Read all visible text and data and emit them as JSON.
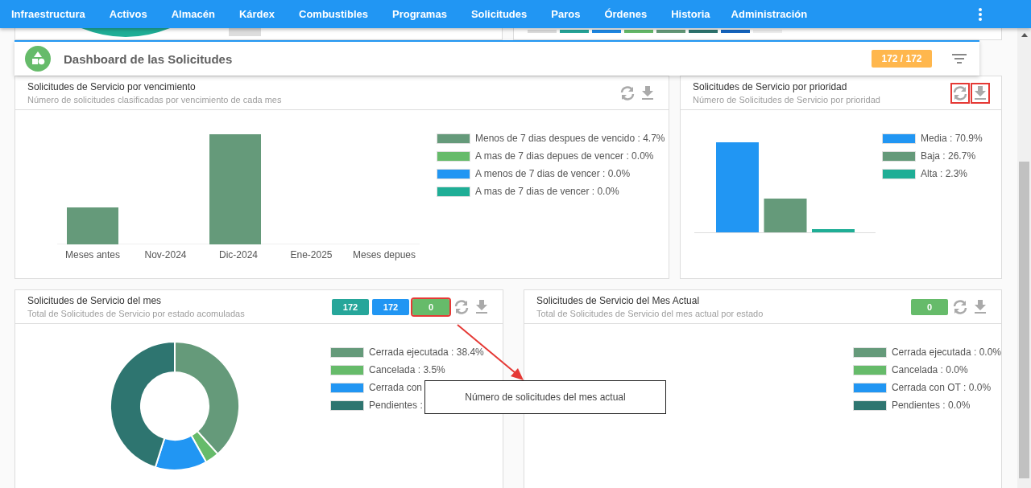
{
  "nav": {
    "items": [
      "Infraestructura",
      "Activos",
      "Almacén",
      "Kárdex",
      "Combustibles",
      "Programas",
      "Solicitudes",
      "Paros",
      "Órdenes",
      "Historia",
      "Administración"
    ]
  },
  "header": {
    "title": "Dashboard de las Solicitudes",
    "badge": "172 / 172"
  },
  "cards": [
    {
      "kind": "timeline",
      "title": "Solicitudes de Servicio por vencimiento",
      "subtitle": "Número de solicitudes clasificadas por vencimiento de cada mes",
      "actions": [
        {
          "kind": "refresh",
          "highlighted": false
        },
        {
          "kind": "download",
          "highlighted": false
        }
      ],
      "x_labels": [
        "Meses antes",
        "Nov-2024",
        "Dic-2024",
        "Ene-2025",
        "Meses depues"
      ],
      "legend": [
        {
          "label": "Menos de 7 dias despues de vencido : 4.7%",
          "color": "#659a7a"
        },
        {
          "label": "A mas de 7 dias depues de vencer : 0.0%",
          "color": "#66bb6a"
        },
        {
          "label": "A menos de 7 dias de vencer : 0.0%",
          "color": "#2196f3"
        },
        {
          "label": "A mas de 7 dias de vencer : 0.0%",
          "color": "#1fae96"
        }
      ]
    },
    {
      "kind": "priority",
      "title": "Solicitudes de Servicio por prioridad",
      "subtitle": "Número de Solicitudes de Servicio por prioridad",
      "actions": [
        {
          "kind": "refresh",
          "highlighted": true
        },
        {
          "kind": "download",
          "highlighted": true
        }
      ],
      "legend": [
        {
          "label": "Media : 70.9%",
          "color": "#2196f3"
        },
        {
          "label": "Baja : 26.7%",
          "color": "#659a7a"
        },
        {
          "label": "Alta : 2.3%",
          "color": "#1fae96"
        }
      ]
    },
    {
      "kind": "donut",
      "title": "Solicitudes de Servicio del mes",
      "subtitle": "Total de Solicitudes de Servicio por estado acomuladas",
      "badges": [
        {
          "text": "172",
          "color": "#26a69a",
          "highlighted": false
        },
        {
          "text": "172",
          "color": "#2196f3",
          "highlighted": false
        },
        {
          "text": "0",
          "color": "#66bb6a",
          "highlighted": true
        }
      ],
      "actions": [
        {
          "kind": "refresh",
          "highlighted": false
        },
        {
          "kind": "download",
          "highlighted": false
        }
      ],
      "legend": [
        {
          "label": "Cerrada ejecutada : 38.4%",
          "color": "#659a7a"
        },
        {
          "label": "Cancelada : 3.5%",
          "color": "#66bb6a"
        },
        {
          "label": "Cerrada con",
          "color": "#2196f3"
        },
        {
          "label": "Pendientes :",
          "color": "#2e7570"
        }
      ]
    },
    {
      "kind": "empty",
      "title": "Solicitudes de Servicio del Mes Actual",
      "subtitle": "Total de Solicitudes de Servicio del mes actual por estado",
      "badges": [
        {
          "text": "0",
          "color": "#66bb6a",
          "highlighted": false
        }
      ],
      "actions": [
        {
          "kind": "refresh",
          "highlighted": false
        },
        {
          "kind": "download",
          "highlighted": false
        }
      ],
      "legend": [
        {
          "label": "Cerrada ejecutada : 0.0%",
          "color": "#659a7a"
        },
        {
          "label": "Cancelada : 0.0%",
          "color": "#66bb6a"
        },
        {
          "label": "Cerrada con OT : 0.0%",
          "color": "#2196f3"
        },
        {
          "label": "Pendientes : 0.0%",
          "color": "#2e7570"
        }
      ]
    }
  ],
  "tooltip": {
    "text": "Número de solicitudes del mes actual"
  }
}
